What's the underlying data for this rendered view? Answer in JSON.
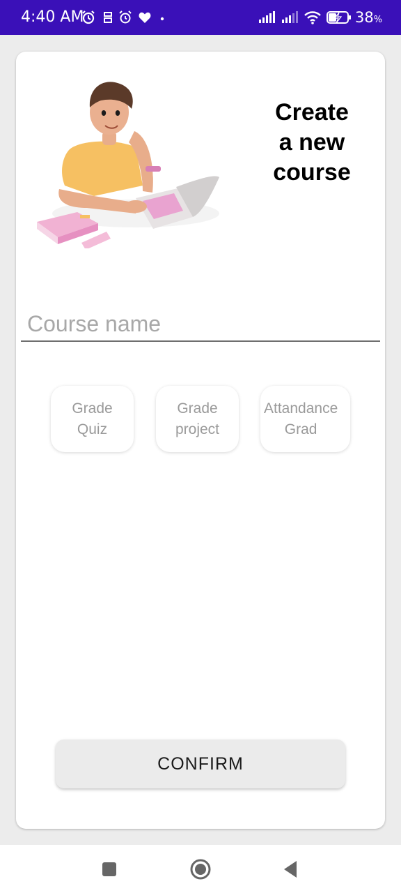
{
  "status_bar": {
    "time": "4:40 AM",
    "battery_percent": "38",
    "battery_unit": "%",
    "background_color": "#3a10b8",
    "icons_left": [
      "alarm-icon",
      "vpn-icon",
      "alarm-clock-icon",
      "heart-icon",
      "dot-icon"
    ],
    "icons_right": [
      "signal-icon",
      "signal-icon",
      "wifi-icon",
      "battery-charging-icon"
    ]
  },
  "header": {
    "title": "Create\na new\ncourse",
    "illustration": "person-with-laptop-illustration"
  },
  "form": {
    "course_name_placeholder": "Course name",
    "course_name_value": ""
  },
  "options": [
    {
      "label": "Grade\nQuiz"
    },
    {
      "label": "Grade\nproject"
    },
    {
      "label": "Attandance\nGrad"
    }
  ],
  "confirm_label": "CONFIRM",
  "nav": {
    "icons": [
      "recents-icon",
      "home-icon",
      "back-icon"
    ]
  }
}
